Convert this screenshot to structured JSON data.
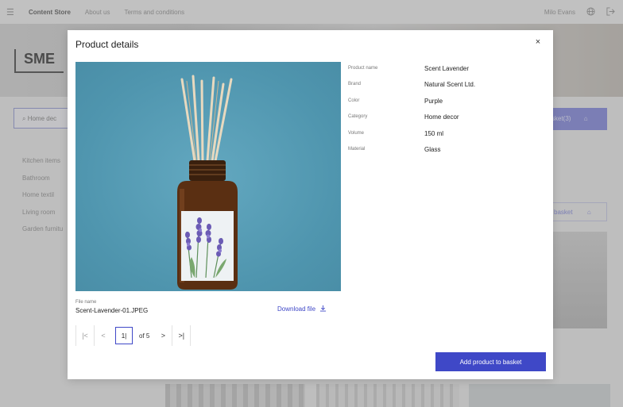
{
  "topbar": {
    "brand": "Content Store",
    "nav": [
      "About us",
      "Terms and conditions"
    ],
    "user": "Milo Evans"
  },
  "background": {
    "logo": "SME",
    "search_placeholder": "Home dec",
    "basket_label": "sket(3)",
    "basket_label2": "basket",
    "categories": [
      "Kitchen items",
      "Bathroom",
      "Home textil",
      "Living room",
      "Garden furnitu"
    ]
  },
  "modal": {
    "title": "Product details",
    "close_symbol": "×",
    "file": {
      "label": "File name",
      "value": "Scent-Lavender-01.JPEG",
      "download_label": "Download file"
    },
    "pager": {
      "first": "|<",
      "prev": "<",
      "current": "1|",
      "of_text": "of 5",
      "next": ">",
      "last": ">|"
    },
    "specs": [
      {
        "label": "Product name",
        "value": "Scent Lavender"
      },
      {
        "label": "Brand",
        "value": "Natural Scent Ltd."
      },
      {
        "label": "Color",
        "value": "Purple"
      },
      {
        "label": "Category",
        "value": "Home decor"
      },
      {
        "label": "Volume",
        "value": "150 ml"
      },
      {
        "label": "Material",
        "value": "Glass"
      }
    ],
    "add_button": "Add product to basket"
  },
  "colors": {
    "accent": "#3f48c7",
    "image_bg": "#4f95ae",
    "bottle": "#5a2f12",
    "lavender": "#6b5bb5"
  },
  "icons": [
    "menu-icon",
    "globe-icon",
    "logout-icon",
    "search-icon",
    "basket-icon",
    "close-icon",
    "download-icon"
  ]
}
